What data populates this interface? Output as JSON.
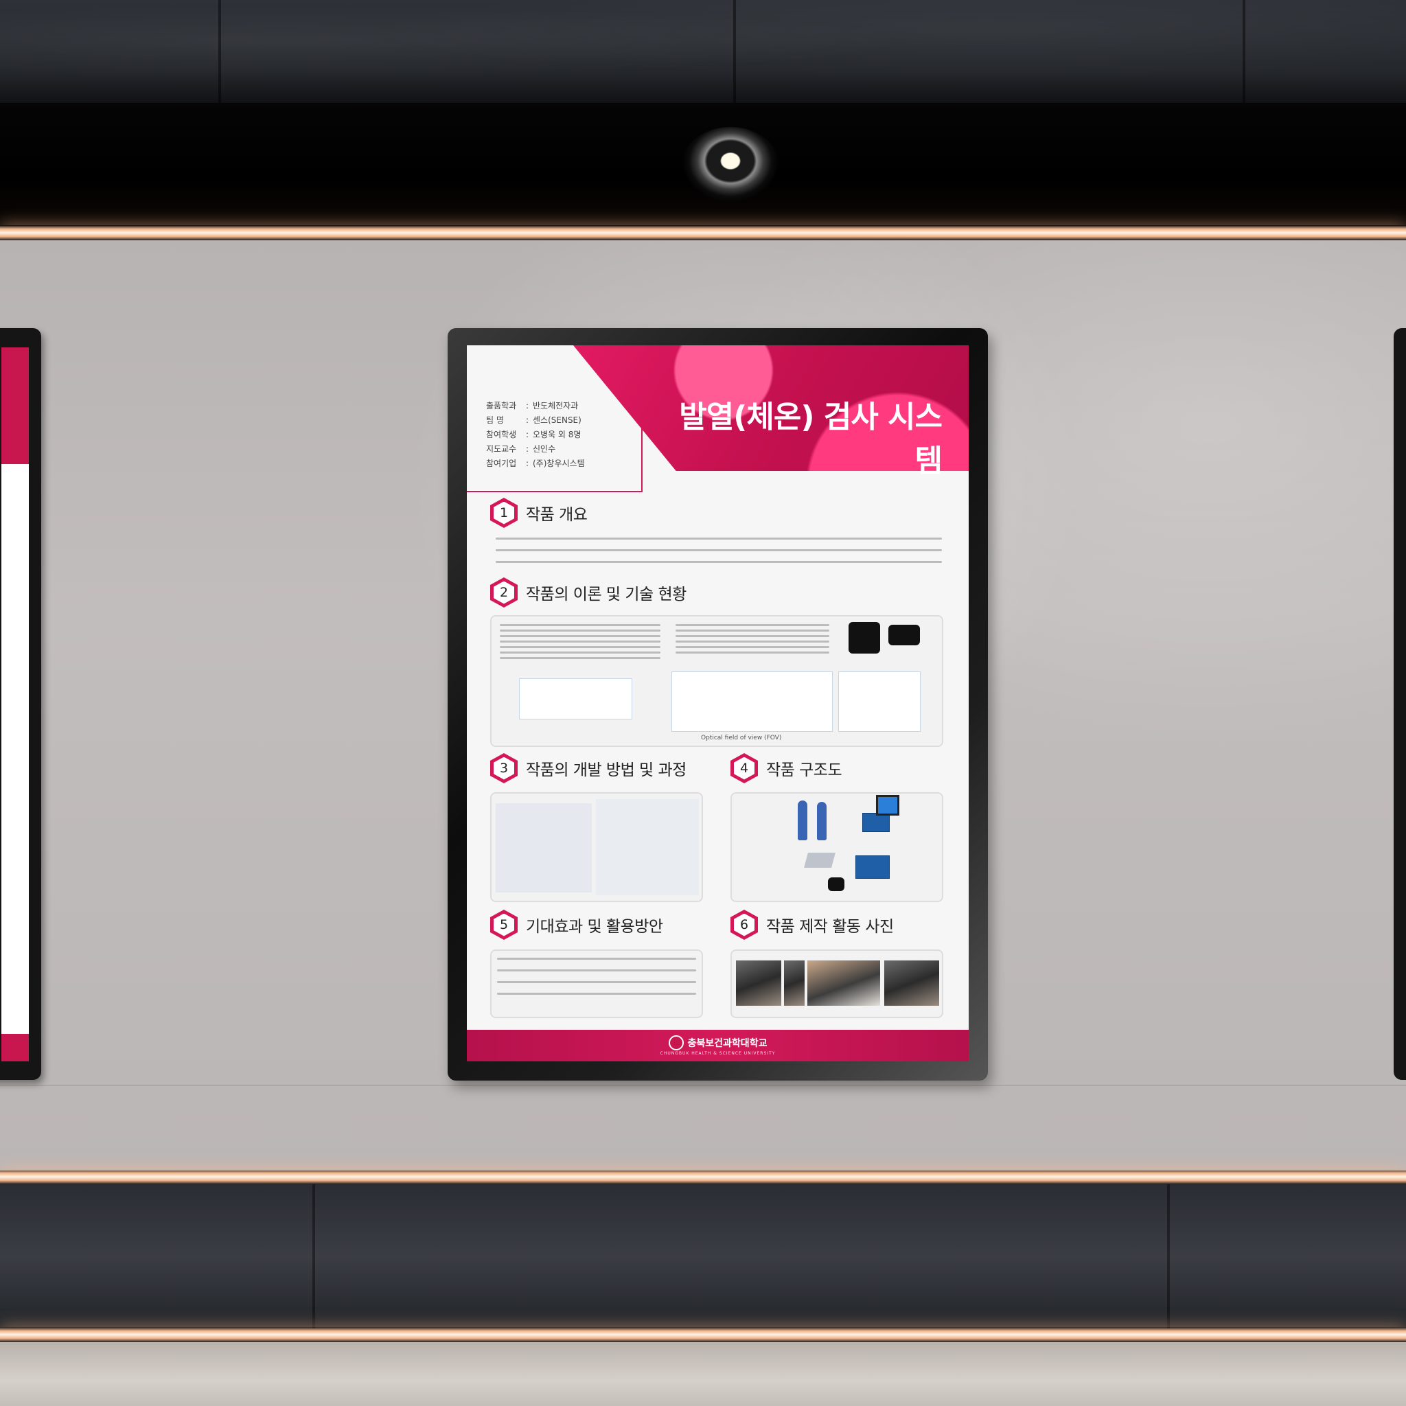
{
  "poster": {
    "title": "발열(체온) 검사 시스템",
    "info": [
      {
        "key": "출품학과",
        "value": "반도체전자과"
      },
      {
        "key": "팀     명",
        "value": "센스(SENSE)"
      },
      {
        "key": "참여학생",
        "value": "오병욱 외 8명"
      },
      {
        "key": "지도교수",
        "value": "신인수"
      },
      {
        "key": "참여기업",
        "value": "(주)창우시스템"
      }
    ],
    "sections": [
      {
        "num": "1",
        "title": "작품 개요"
      },
      {
        "num": "2",
        "title": "작품의 이론 및 기술 현황"
      },
      {
        "num": "3",
        "title": "작품의 개발 방법 및 과정"
      },
      {
        "num": "4",
        "title": "작품 구조도"
      },
      {
        "num": "5",
        "title": "기대효과 및 활용방안"
      },
      {
        "num": "6",
        "title": "작품 제작 활동 사진"
      }
    ],
    "figure_labels": {
      "fov": "Optical field of view (FOV)"
    },
    "footer": {
      "name": "충북보건과학대학교",
      "sub": "CHUNGBUK HEALTH & SCIENCE UNIVERSITY"
    }
  },
  "colors": {
    "accent": "#d21a56",
    "frame": "#1a1a1a",
    "wall": "#bdb8b8"
  }
}
